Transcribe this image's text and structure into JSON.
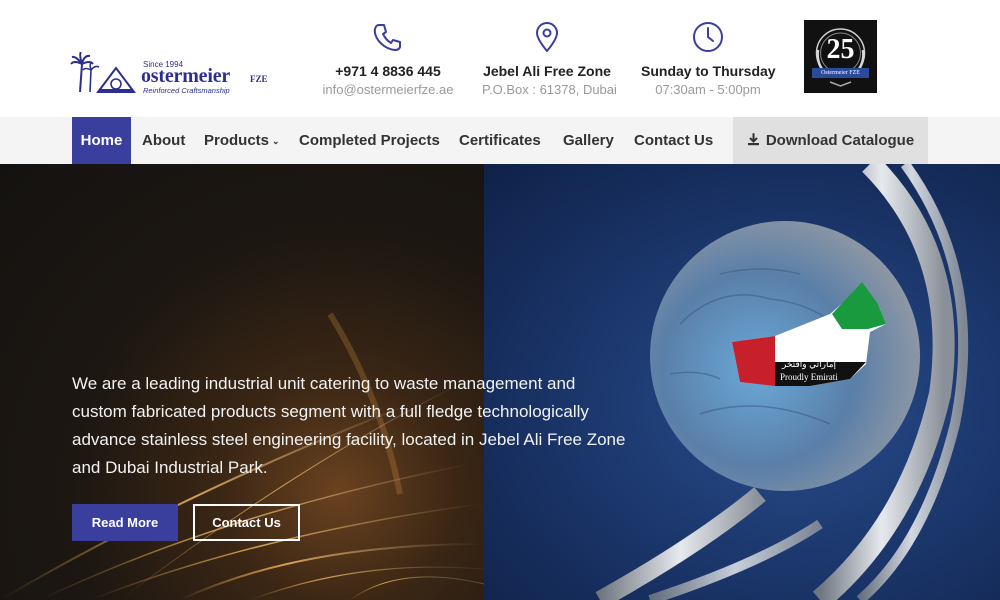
{
  "brand": {
    "since": "Since 1994",
    "name": "ostermeier",
    "suffix": "FZE",
    "tagline": "Reinforced Craftsmanship",
    "colors": {
      "primary": "#3a3f9e",
      "logo": "#2c2f8f"
    }
  },
  "contact_info": [
    {
      "icon": "phone-icon",
      "line1": "+971 4 8836 445",
      "line2": "info@ostermeierfze.ae"
    },
    {
      "icon": "location-pin-icon",
      "line1": "Jebel Ali Free Zone",
      "line2": "P.O.Box : 61378, Dubai"
    },
    {
      "icon": "clock-icon",
      "line1": "Sunday to Thursday",
      "line2": "07:30am - 5:00pm"
    }
  ],
  "badge": {
    "number": "25",
    "ribbon": "Ostermeier FZE"
  },
  "nav": {
    "items": [
      {
        "label": "Home",
        "active": true
      },
      {
        "label": "About"
      },
      {
        "label": "Products",
        "dropdown": true
      },
      {
        "label": "Completed Projects"
      },
      {
        "label": "Certificates"
      },
      {
        "label": "Gallery"
      },
      {
        "label": "Contact Us"
      }
    ],
    "download": {
      "label": "Download Catalogue",
      "icon": "download-icon"
    }
  },
  "hero": {
    "text": "We are a leading industrial unit catering to waste management and custom fabricated products segment with a full fledge technologically advance stainless steel engineering facility, located in Jebel Ali Free Zone and Dubai Industrial Park.",
    "read_more": "Read More",
    "contact_us": "Contact Us",
    "globe_label_ar": "إماراتي وافتخر",
    "globe_label_en": "Proudly Emirati"
  }
}
